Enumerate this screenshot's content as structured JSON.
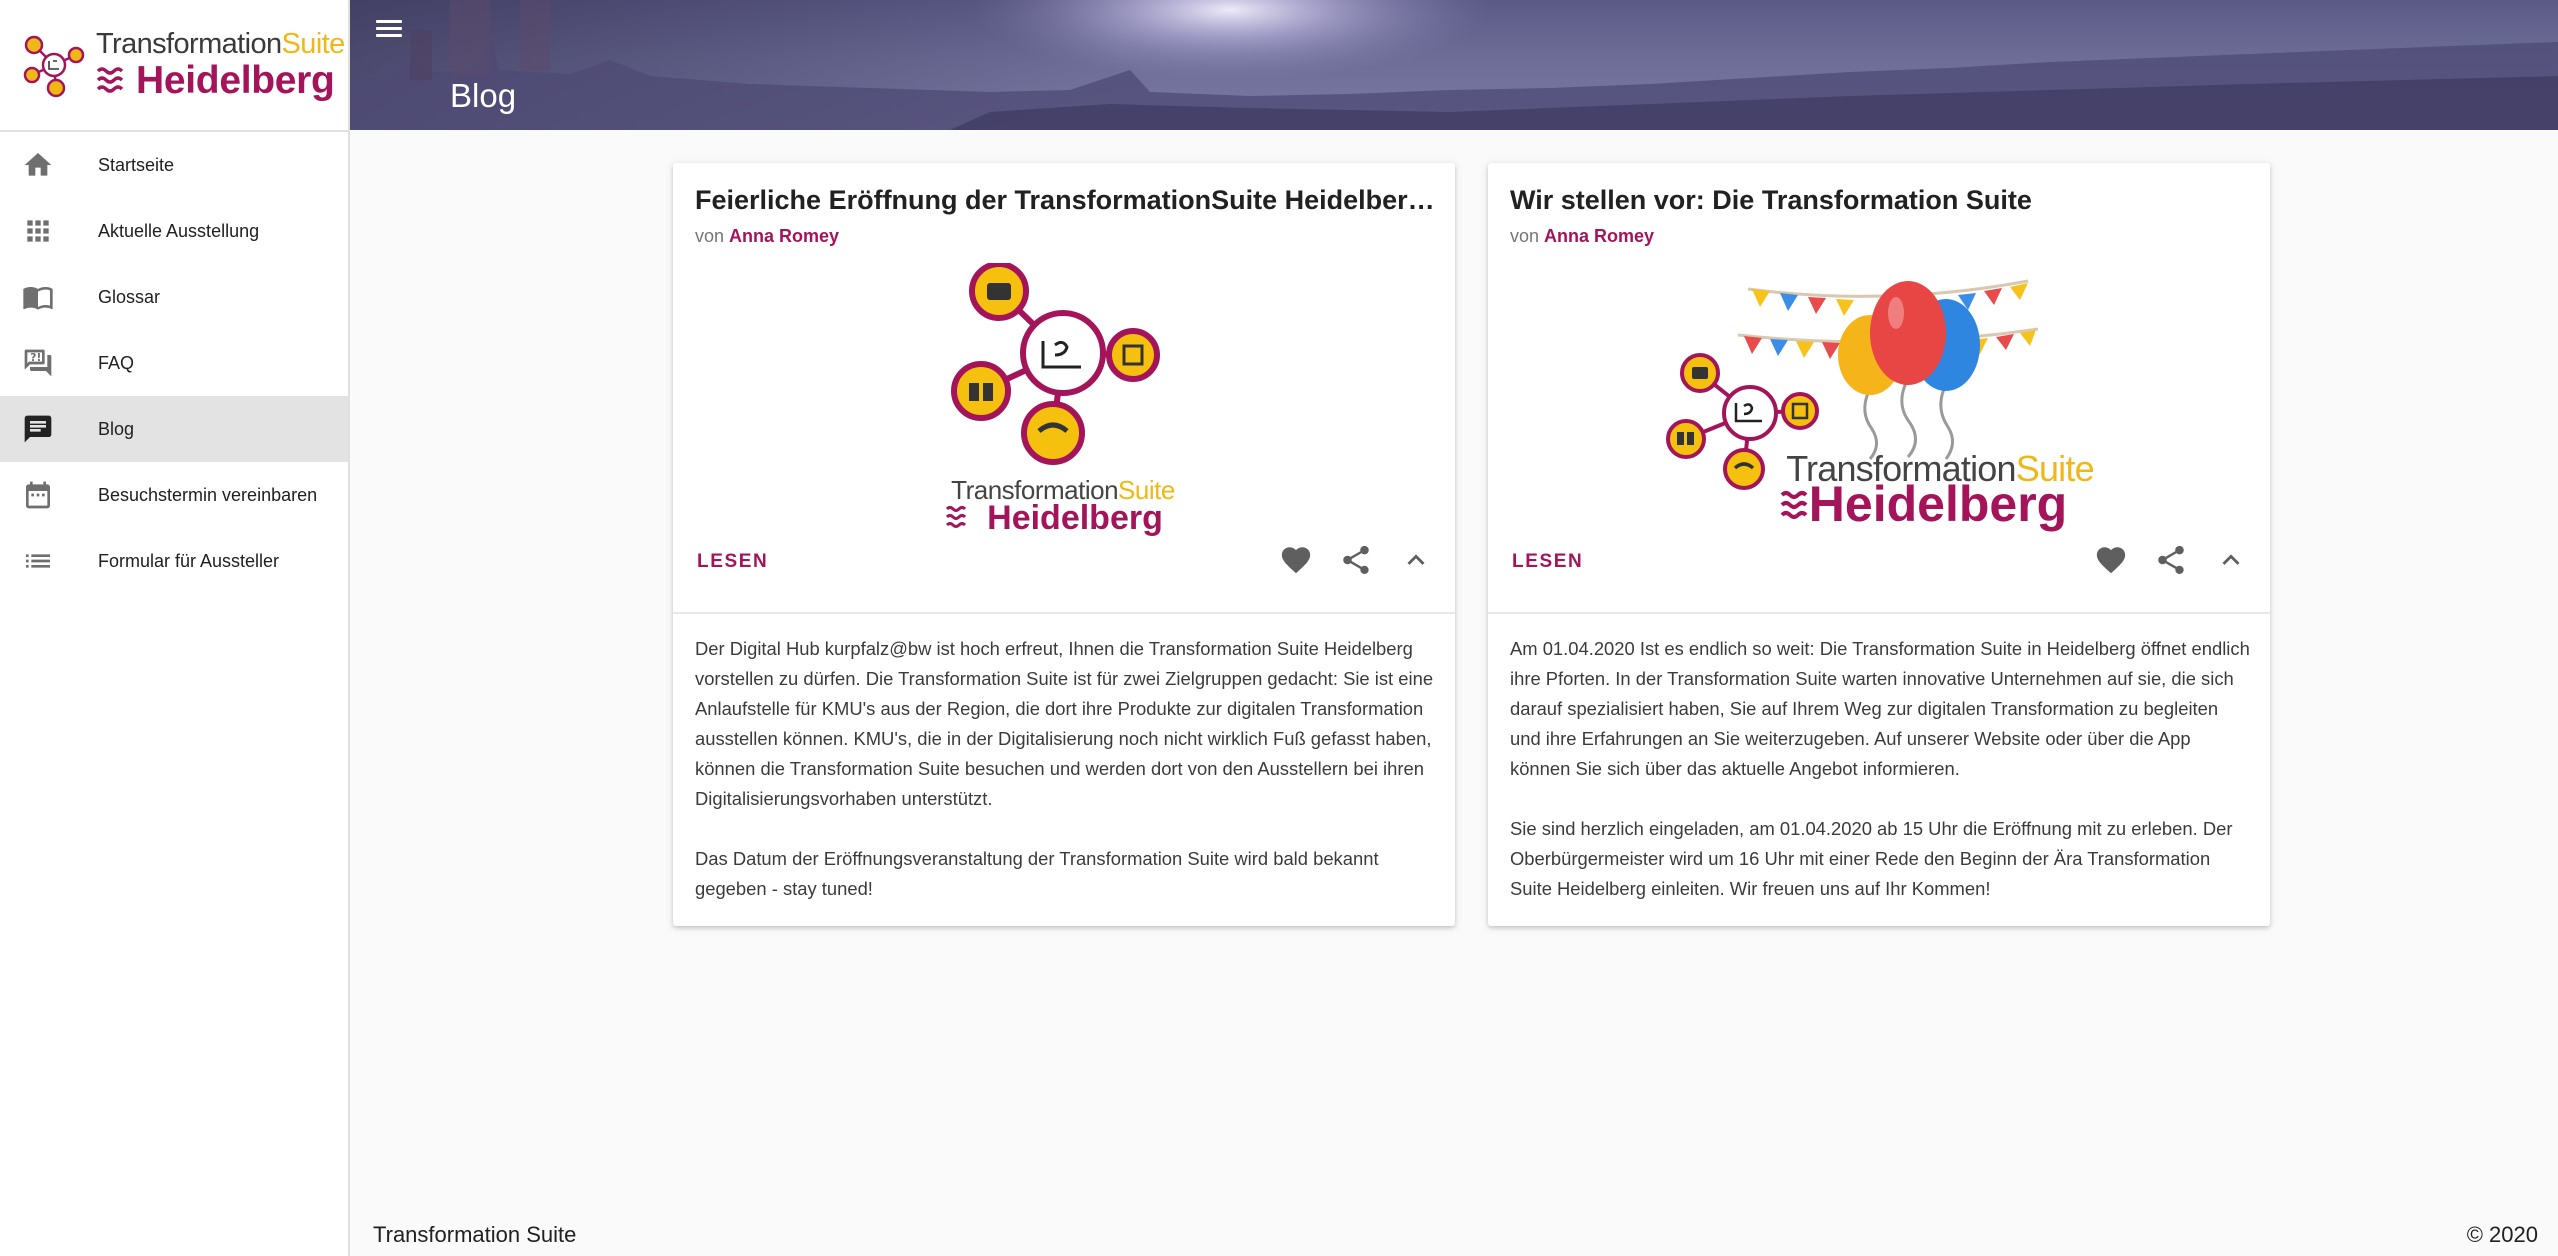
{
  "brand": {
    "logo_line1": "Transformation",
    "logo_line1_accent": "Suite",
    "logo_line2": "Heidelberg",
    "colors": {
      "primary": "#a4145a",
      "accent": "#f0b816"
    }
  },
  "header": {
    "menu_icon": "menu-icon",
    "title": "Blog"
  },
  "sidebar": {
    "items": [
      {
        "label": "Startseite",
        "icon": "home-icon",
        "active": false
      },
      {
        "label": "Aktuelle Ausstellung",
        "icon": "apps-grid-icon",
        "active": false
      },
      {
        "label": "Glossar",
        "icon": "open-book-icon",
        "active": false
      },
      {
        "label": "FAQ",
        "icon": "question-chat-icon",
        "active": false
      },
      {
        "label": "Blog",
        "icon": "chat-message-icon",
        "active": true
      },
      {
        "label": "Besuchstermin vereinbaren",
        "icon": "calendar-icon",
        "active": false
      },
      {
        "label": "Formular für Aussteller",
        "icon": "list-form-icon",
        "active": false
      }
    ]
  },
  "posts": [
    {
      "title": "Feierliche Eröffnung der TransformationSuite Heidelberg...",
      "by_label": "von",
      "author": "Anna Romey",
      "image_logo_line1": "Transformation",
      "image_logo_line1_accent": "Suite",
      "image_logo_line2": "Heidelberg",
      "read_label": "LESEN",
      "paragraphs": [
        "Der Digital Hub kurpfalz@bw ist hoch erfreut, Ihnen die Transformation Suite Heidelberg vorstellen zu dürfen. Die Transformation Suite ist für zwei Zielgruppen gedacht: Sie ist eine Anlaufstelle für KMU's aus der Region, die dort ihre Produkte zur digitalen Transformation ausstellen können. KMU's, die in der Digitalisierung noch nicht wirklich Fuß gefasst haben, können die Transformation Suite besuchen und werden dort von den Ausstellern bei ihren Digitalisierungsvorhaben unterstützt.",
        "Das Datum der Eröffnungsveranstaltung der Transformation Suite wird bald bekannt gegeben - stay tuned!"
      ]
    },
    {
      "title": "Wir stellen vor: Die Transformation Suite",
      "by_label": "von",
      "author": "Anna Romey",
      "image_logo_line1": "Transformation",
      "image_logo_line1_accent": "Suite",
      "image_logo_line2": "Heidelberg",
      "read_label": "LESEN",
      "paragraphs": [
        "Am 01.04.2020 Ist es endlich so weit: Die Transformation Suite in Heidelberg öffnet endlich ihre Pforten. In der Transformation Suite warten innovative Unternehmen auf sie, die sich darauf spezialisiert haben, Sie auf Ihrem Weg zur digitalen Transformation zu begleiten und ihre Erfahrungen an Sie weiterzugeben. Auf unserer Website oder über die App können Sie sich über das aktuelle Angebot informieren.",
        "Sie sind herzlich eingeladen, am 01.04.2020 ab 15 Uhr die Eröffnung mit zu erleben. Der Oberbürgermeister wird um 16 Uhr mit einer Rede den Beginn der Ära Transformation Suite Heidelberg einleiten. Wir freuen uns auf Ihr Kommen!"
      ]
    }
  ],
  "footer": {
    "left": "Transformation Suite",
    "right": "© 2020"
  }
}
